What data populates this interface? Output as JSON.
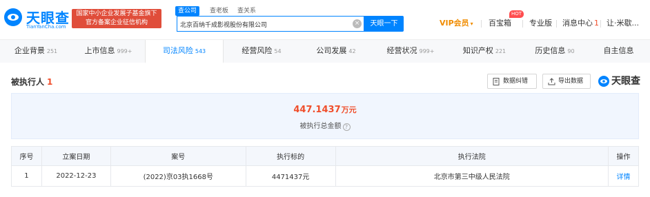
{
  "brand": {
    "name_cn": "天眼查",
    "name_en": "TianYanCha.com",
    "promo_line1": "国家中小企业发展子基金旗下",
    "promo_line2": "官方备案企业征信机构"
  },
  "search": {
    "tabs": [
      "查公司",
      "查老板",
      "查关系"
    ],
    "value": "北京百纳千成影视股份有限公司",
    "button": "天眼一下"
  },
  "nav": {
    "vip": "VIP会员",
    "baibaoxiang": "百宝箱",
    "hot": "HOT",
    "pro": "专业版",
    "messages": "消息中心",
    "messages_count": "1",
    "user": "让·米歇..."
  },
  "tabs": [
    {
      "label": "企业背景",
      "count": "251"
    },
    {
      "label": "上市信息",
      "count": "999+"
    },
    {
      "label": "司法风险",
      "count": "543"
    },
    {
      "label": "经营风险",
      "count": "54"
    },
    {
      "label": "公司发展",
      "count": "42"
    },
    {
      "label": "经营状况",
      "count": "999+"
    },
    {
      "label": "知识产权",
      "count": "221"
    },
    {
      "label": "历史信息",
      "count": "90"
    },
    {
      "label": "自主信息",
      "count": ""
    }
  ],
  "section": {
    "title": "被执行人",
    "count": "1",
    "btn_error": "数据纠错",
    "btn_export": "导出数据",
    "brand_mark": "天眼查"
  },
  "summary": {
    "amount": "447.1437",
    "unit": "万元",
    "label": "被执行总金额"
  },
  "table": {
    "headers": [
      "序号",
      "立案日期",
      "案号",
      "执行标的",
      "执行法院",
      "操作"
    ],
    "rows": [
      [
        "1",
        "2022-12-23",
        "(2022)京03执1668号",
        "4471437元",
        "北京市第三中级人民法院",
        "详情"
      ]
    ]
  },
  "colors": {
    "accent": "#0084ff",
    "danger": "#f04e2b",
    "vip": "#f08c00"
  }
}
